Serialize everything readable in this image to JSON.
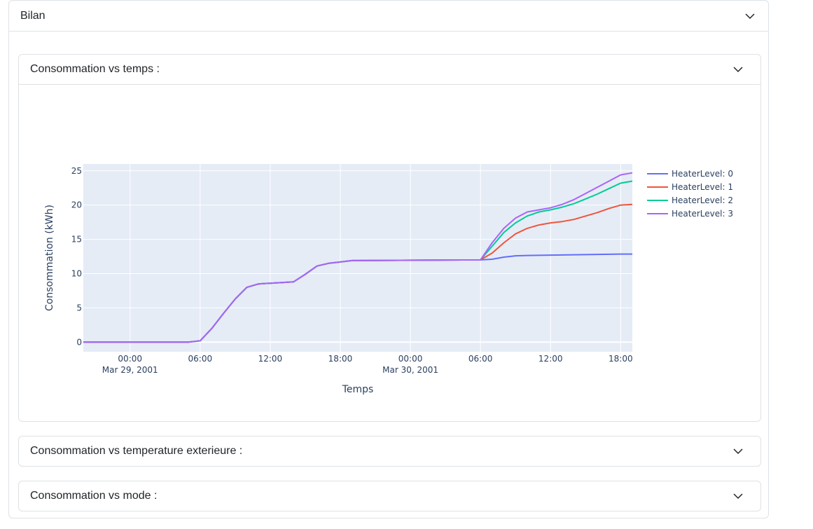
{
  "outer": {
    "title": "Bilan"
  },
  "sections": [
    {
      "title": "Consommation vs temps :"
    },
    {
      "title": "Consommation vs temperature exterieure :"
    },
    {
      "title": "Consommation vs mode :"
    }
  ],
  "chart_data": {
    "type": "line",
    "title": "",
    "xlabel": "Temps",
    "ylabel": "Consommation (kWh)",
    "xlim": [
      "2001-03-28 20:00",
      "2001-03-30 19:00"
    ],
    "ylim": [
      -1.4,
      26
    ],
    "grid": true,
    "legend_position": "right",
    "x_ticks": [
      {
        "at": "2001-03-29 00:00",
        "label": "00:00",
        "sublabel": "Mar 29, 2001"
      },
      {
        "at": "2001-03-29 06:00",
        "label": "06:00",
        "sublabel": ""
      },
      {
        "at": "2001-03-29 12:00",
        "label": "12:00",
        "sublabel": ""
      },
      {
        "at": "2001-03-29 18:00",
        "label": "18:00",
        "sublabel": ""
      },
      {
        "at": "2001-03-30 00:00",
        "label": "00:00",
        "sublabel": "Mar 30, 2001"
      },
      {
        "at": "2001-03-30 06:00",
        "label": "06:00",
        "sublabel": ""
      },
      {
        "at": "2001-03-30 12:00",
        "label": "12:00",
        "sublabel": ""
      },
      {
        "at": "2001-03-30 18:00",
        "label": "18:00",
        "sublabel": ""
      }
    ],
    "y_ticks": [
      0,
      5,
      10,
      15,
      20,
      25
    ],
    "shared_points": [
      [
        "2001-03-28 20:00",
        0
      ],
      [
        "2001-03-29 05:00",
        0
      ],
      [
        "2001-03-29 06:00",
        0.2
      ],
      [
        "2001-03-29 07:00",
        2.0
      ],
      [
        "2001-03-29 08:00",
        4.2
      ],
      [
        "2001-03-29 09:00",
        6.3
      ],
      [
        "2001-03-29 10:00",
        8.0
      ],
      [
        "2001-03-29 11:00",
        8.5
      ],
      [
        "2001-03-29 12:00",
        8.6
      ],
      [
        "2001-03-29 13:00",
        8.7
      ],
      [
        "2001-03-29 14:00",
        8.8
      ],
      [
        "2001-03-29 15:00",
        9.9
      ],
      [
        "2001-03-29 16:00",
        11.1
      ],
      [
        "2001-03-29 17:00",
        11.5
      ],
      [
        "2001-03-29 18:00",
        11.7
      ],
      [
        "2001-03-29 19:00",
        11.9
      ],
      [
        "2001-03-30 06:00",
        12.0
      ]
    ],
    "series": [
      {
        "name": "HeaterLevel: 0",
        "color": "#636efa",
        "points": [
          [
            "2001-03-30 07:00",
            12.1
          ],
          [
            "2001-03-30 08:00",
            12.4
          ],
          [
            "2001-03-30 09:00",
            12.6
          ],
          [
            "2001-03-30 10:00",
            12.65
          ],
          [
            "2001-03-30 12:00",
            12.7
          ],
          [
            "2001-03-30 14:00",
            12.75
          ],
          [
            "2001-03-30 16:00",
            12.8
          ],
          [
            "2001-03-30 18:00",
            12.85
          ],
          [
            "2001-03-30 19:00",
            12.85
          ]
        ]
      },
      {
        "name": "HeaterLevel: 1",
        "color": "#EF553B",
        "points": [
          [
            "2001-03-30 07:00",
            13.0
          ],
          [
            "2001-03-30 08:00",
            14.5
          ],
          [
            "2001-03-30 09:00",
            15.8
          ],
          [
            "2001-03-30 10:00",
            16.6
          ],
          [
            "2001-03-30 11:00",
            17.1
          ],
          [
            "2001-03-30 12:00",
            17.4
          ],
          [
            "2001-03-30 13:00",
            17.6
          ],
          [
            "2001-03-30 14:00",
            17.9
          ],
          [
            "2001-03-30 15:00",
            18.4
          ],
          [
            "2001-03-30 16:00",
            18.9
          ],
          [
            "2001-03-30 17:00",
            19.5
          ],
          [
            "2001-03-30 18:00",
            20.0
          ],
          [
            "2001-03-30 19:00",
            20.1
          ]
        ]
      },
      {
        "name": "HeaterLevel: 2",
        "color": "#00cc96",
        "points": [
          [
            "2001-03-30 07:00",
            14.0
          ],
          [
            "2001-03-30 08:00",
            16.0
          ],
          [
            "2001-03-30 09:00",
            17.4
          ],
          [
            "2001-03-30 10:00",
            18.4
          ],
          [
            "2001-03-30 11:00",
            19.0
          ],
          [
            "2001-03-30 12:00",
            19.3
          ],
          [
            "2001-03-30 13:00",
            19.7
          ],
          [
            "2001-03-30 14:00",
            20.2
          ],
          [
            "2001-03-30 15:00",
            20.9
          ],
          [
            "2001-03-30 16:00",
            21.6
          ],
          [
            "2001-03-30 17:00",
            22.4
          ],
          [
            "2001-03-30 18:00",
            23.2
          ],
          [
            "2001-03-30 19:00",
            23.5
          ]
        ]
      },
      {
        "name": "HeaterLevel: 3",
        "color": "#ab63fa",
        "points": [
          [
            "2001-03-30 07:00",
            14.5
          ],
          [
            "2001-03-30 08:00",
            16.6
          ],
          [
            "2001-03-30 09:00",
            18.1
          ],
          [
            "2001-03-30 10:00",
            19.0
          ],
          [
            "2001-03-30 11:00",
            19.3
          ],
          [
            "2001-03-30 12:00",
            19.6
          ],
          [
            "2001-03-30 13:00",
            20.1
          ],
          [
            "2001-03-30 14:00",
            20.8
          ],
          [
            "2001-03-30 15:00",
            21.7
          ],
          [
            "2001-03-30 16:00",
            22.6
          ],
          [
            "2001-03-30 17:00",
            23.5
          ],
          [
            "2001-03-30 18:00",
            24.4
          ],
          [
            "2001-03-30 19:00",
            24.7
          ]
        ]
      }
    ]
  }
}
